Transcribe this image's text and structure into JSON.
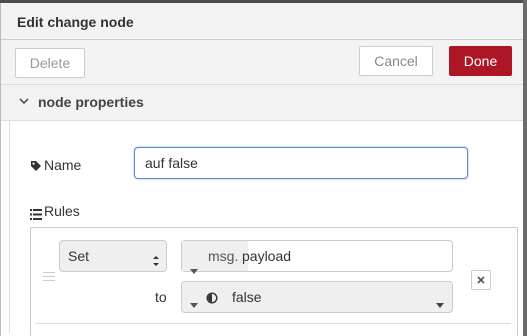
{
  "tray": {
    "title": "Edit change node"
  },
  "toolbar": {
    "delete_label": "Delete",
    "cancel_label": "Cancel",
    "done_label": "Done"
  },
  "section": {
    "label": "node properties",
    "chevron_icon": "chevron-down-icon"
  },
  "form": {
    "name_label": "Name",
    "name_icon": "tag-icon",
    "name_value": "auf false",
    "rules_label": "Rules",
    "rules_icon": "list-icon"
  },
  "rules": [
    {
      "action": "Set",
      "property_type": "msg.",
      "property_value": "payload",
      "to_label": "to",
      "value_type_icon": "boolean-toggle-icon",
      "value": "false",
      "remove_icon": "close-icon"
    }
  ],
  "colors": {
    "done_button": "#ad1625",
    "focus_border": "#5a8cc6"
  }
}
